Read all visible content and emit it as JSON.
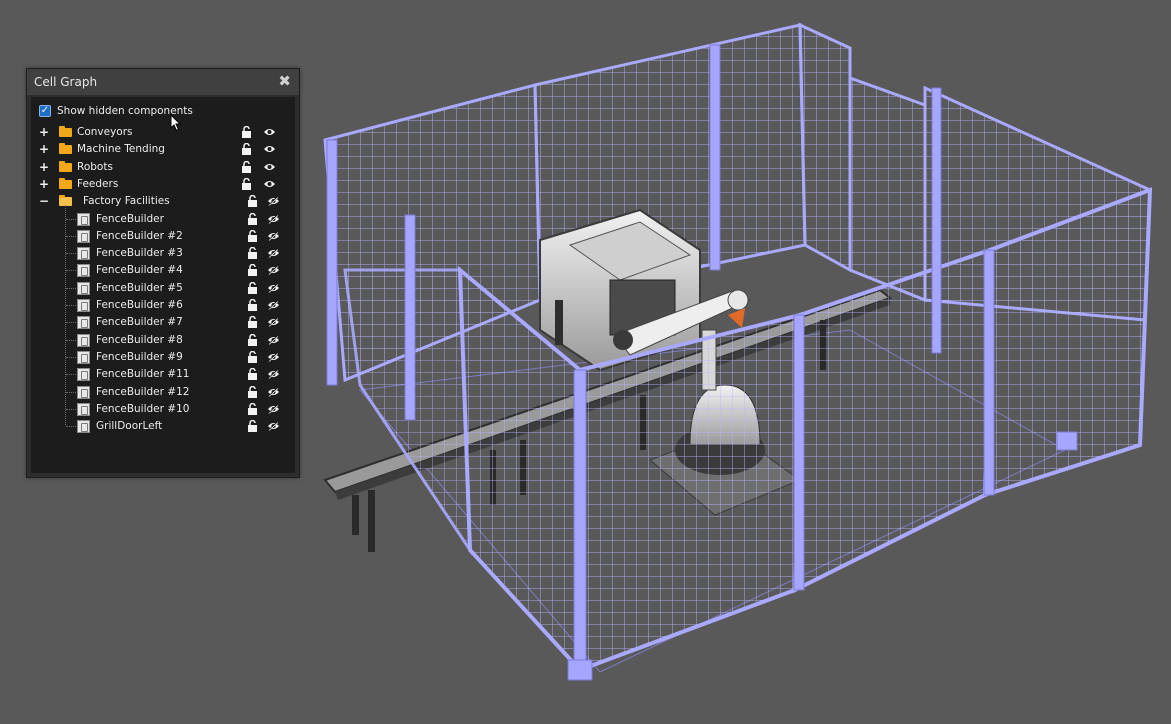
{
  "panel": {
    "title": "Cell Graph",
    "close_glyph": "✖",
    "show_hidden": {
      "label": "Show hidden components",
      "checked": true
    },
    "top_items": [
      {
        "label": "Conveyors",
        "icon": "folder-icon",
        "expander": "+"
      },
      {
        "label": "Machine Tending",
        "icon": "folder-icon",
        "expander": "+"
      },
      {
        "label": "Robots",
        "icon": "folder-icon",
        "expander": "+"
      },
      {
        "label": "Feeders",
        "icon": "folder-icon",
        "expander": "+"
      },
      {
        "label": "Factory Facilities",
        "icon": "open-folder-icon",
        "expander": "−"
      }
    ],
    "children": [
      {
        "label": "FenceBuilder"
      },
      {
        "label": "FenceBuilder #2"
      },
      {
        "label": "FenceBuilder #3"
      },
      {
        "label": "FenceBuilder #4"
      },
      {
        "label": "FenceBuilder #5"
      },
      {
        "label": "FenceBuilder #6"
      },
      {
        "label": "FenceBuilder #7"
      },
      {
        "label": "FenceBuilder #8"
      },
      {
        "label": "FenceBuilder #9"
      },
      {
        "label": "FenceBuilder #11"
      },
      {
        "label": "FenceBuilder #12"
      },
      {
        "label": "FenceBuilder #10"
      },
      {
        "label": "GrillDoorLeft"
      }
    ]
  },
  "colors": {
    "background": "#595959",
    "fence": "#a9a9ff",
    "folder": "#f3a81a",
    "checkbox": "#1e6fc3"
  }
}
